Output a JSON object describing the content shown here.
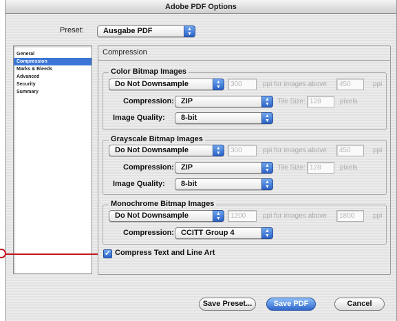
{
  "window": {
    "title": "Adobe PDF Options"
  },
  "preset": {
    "label": "Preset:",
    "value": "Ausgabe PDF"
  },
  "sidebar": {
    "items": [
      {
        "label": "General"
      },
      {
        "label": "Compression"
      },
      {
        "label": "Marks & Bleeds"
      },
      {
        "label": "Advanced"
      },
      {
        "label": "Security"
      },
      {
        "label": "Summary"
      }
    ],
    "selected_index": 1
  },
  "panel": {
    "title": "Compression"
  },
  "color": {
    "title": "Color Bitmap Images",
    "downsample": "Do Not Downsample",
    "ppi": "300",
    "ppi_label": "ppi for images above",
    "above": "450",
    "ppi_unit": "ppi",
    "compression_label": "Compression:",
    "compression": "ZIP",
    "tile_label": "Tile Size:",
    "tile": "128",
    "tile_unit": "pixels",
    "quality_label": "Image Quality:",
    "quality": "8-bit"
  },
  "gray": {
    "title": "Grayscale Bitmap Images",
    "downsample": "Do Not Downsample",
    "ppi": "300",
    "ppi_label": "ppi for images above",
    "above": "450",
    "ppi_unit": "ppi",
    "compression_label": "Compression:",
    "compression": "ZIP",
    "tile_label": "Tile Size:",
    "tile": "128",
    "tile_unit": "pixels",
    "quality_label": "Image Quality:",
    "quality": "8-bit"
  },
  "mono": {
    "title": "Monochrome Bitmap Images",
    "downsample": "Do Not Downsample",
    "ppi": "1200",
    "ppi_label": "ppi for images above",
    "above": "1800",
    "ppi_unit": "ppi",
    "compression_label": "Compression:",
    "compression": "CCITT Group 4"
  },
  "compress_text": {
    "label": "Compress Text and Line Art",
    "checked": true
  },
  "buttons": {
    "save_preset": "Save Preset...",
    "save_pdf": "Save PDF",
    "cancel": "Cancel"
  },
  "colors": {
    "accent": "#2c63c7",
    "callout": "#c4151c"
  }
}
